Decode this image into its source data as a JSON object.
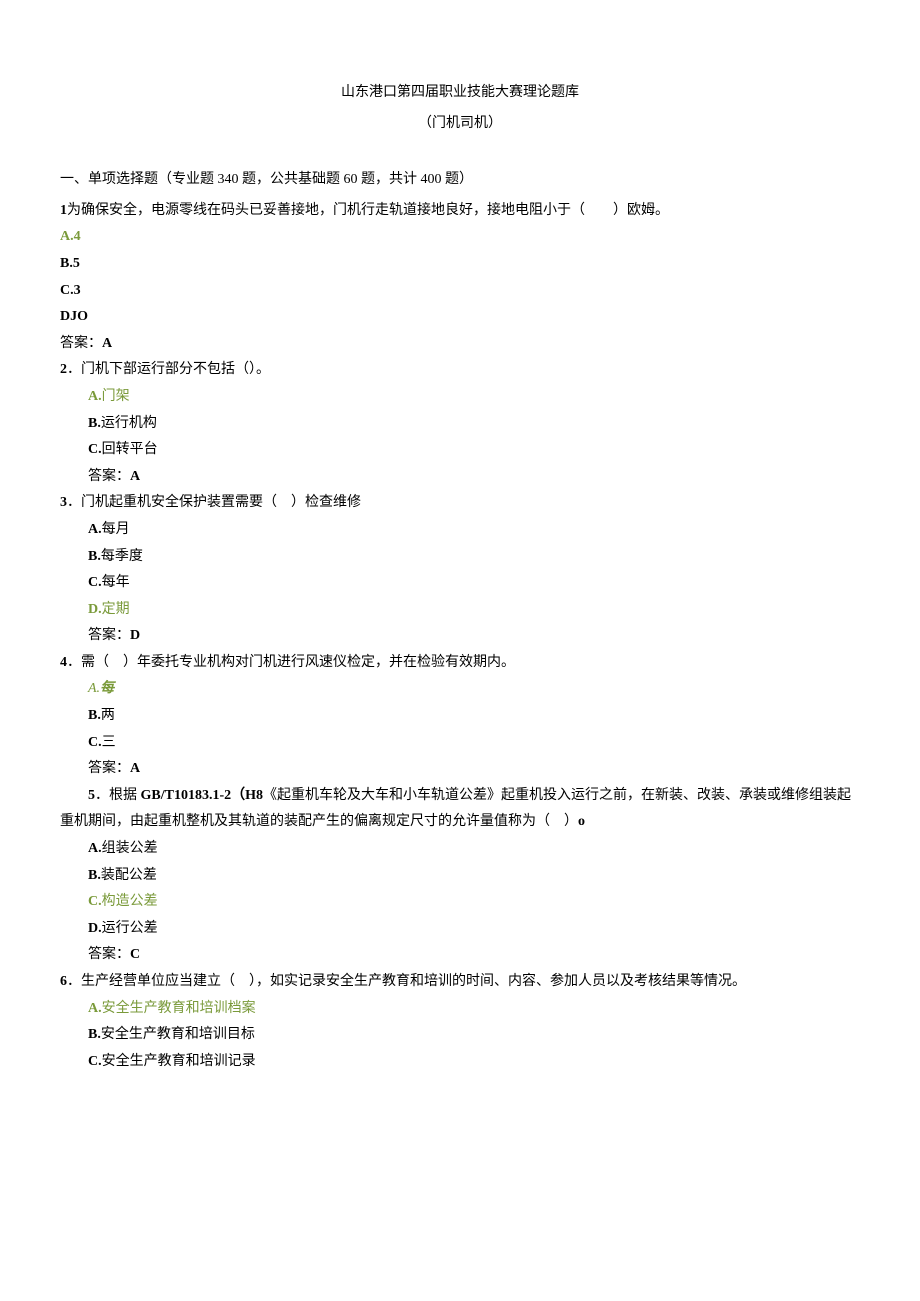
{
  "title": "山东港口第四届职业技能大赛理论题库",
  "subtitle": "（门机司机）",
  "section_heading": "一、单项选择题（专业题 340 题，公共基础题 60 题，共计 400 题）",
  "q1": {
    "num": "1",
    "text": "为确保安全，电源零线在码头已妥善接地，门机行走轨道接地良好，接地电阻小于（　　）欧姆。",
    "a": "A.4",
    "b": "B.5",
    "c": "C.3",
    "d": "DJO",
    "ans": "答案：A"
  },
  "q2": {
    "num": "2",
    "text": "．门机下部运行部分不包括（）。",
    "a": "A.门架",
    "b": "B.运行机构",
    "c": "C.回转平台",
    "ans": "答案：A"
  },
  "q3": {
    "num": "3",
    "text": "．门机起重机安全保护装置需要（　）检查维修",
    "a": "A.每月",
    "b": "B.每季度",
    "c": "C.每年",
    "d": "D.定期",
    "ans": "答案：D"
  },
  "q4": {
    "num": "4",
    "text": "．需（　）年委托专业机构对门机进行风速仪检定，并在检验有效期内。",
    "a_prefix": "A.",
    "a_val": "每",
    "b": "B.两",
    "c": "C.三",
    "ans": "答案：A"
  },
  "q5": {
    "num": "5",
    "text_part1": "．根据 ",
    "text_bold1": "GB/T10183.1-2（H8",
    "text_part2": "《起重机车轮及大车和小车轨道公差》起重机投入运行之前，在新装、改装、承装或维修组装起重机期间，由起重机整机及其轨道的装配产生的偏离规定尺寸的允许量值称为（　）",
    "text_bold2": "o",
    "a": "A.组装公差",
    "b": "B.装配公差",
    "c": "C.构造公差",
    "d": "D.运行公差",
    "ans": "答案：C"
  },
  "q6": {
    "num": "6",
    "text": "．生产经营单位应当建立（　），如实记录安全生产教育和培训的时间、内容、参加人员以及考核结果等情况。",
    "a": "A.安全生产教育和培训档案",
    "b": "B.安全生产教育和培训目标",
    "c": "C.安全生产教育和培训记录"
  }
}
